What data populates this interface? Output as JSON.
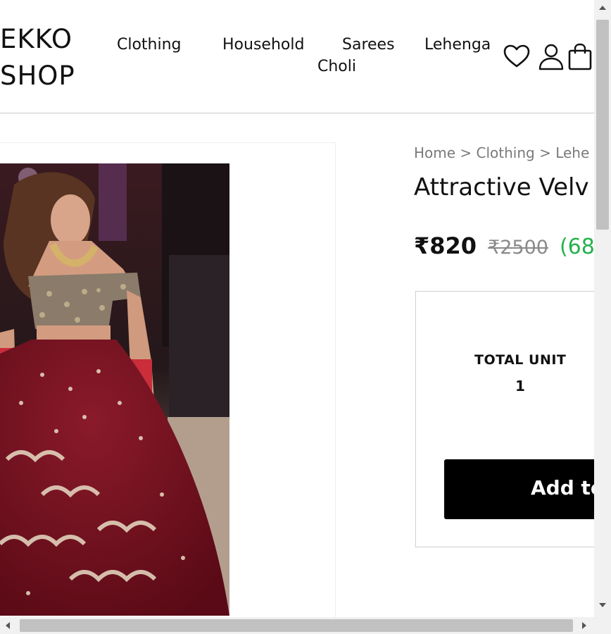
{
  "header": {
    "logo": "EKKO\nSHOP",
    "nav": [
      "Clothing",
      "Household",
      "Sarees",
      "Lehenga",
      "Choli"
    ],
    "icons": [
      "heart-icon",
      "user-icon",
      "shopping-bag-icon"
    ]
  },
  "product": {
    "breadcrumb": "Home > Clothing > Lehe",
    "title": "Attractive Velv",
    "price": "₹820",
    "mrp": "₹2500",
    "discount": "(68",
    "total_unit_label": "TOTAL UNIT",
    "total_unit_value": "1",
    "add_button": "Add to"
  },
  "colors": {
    "discount": "#22b24c",
    "button": "#000000",
    "lehenga": "#6e0f1c"
  }
}
